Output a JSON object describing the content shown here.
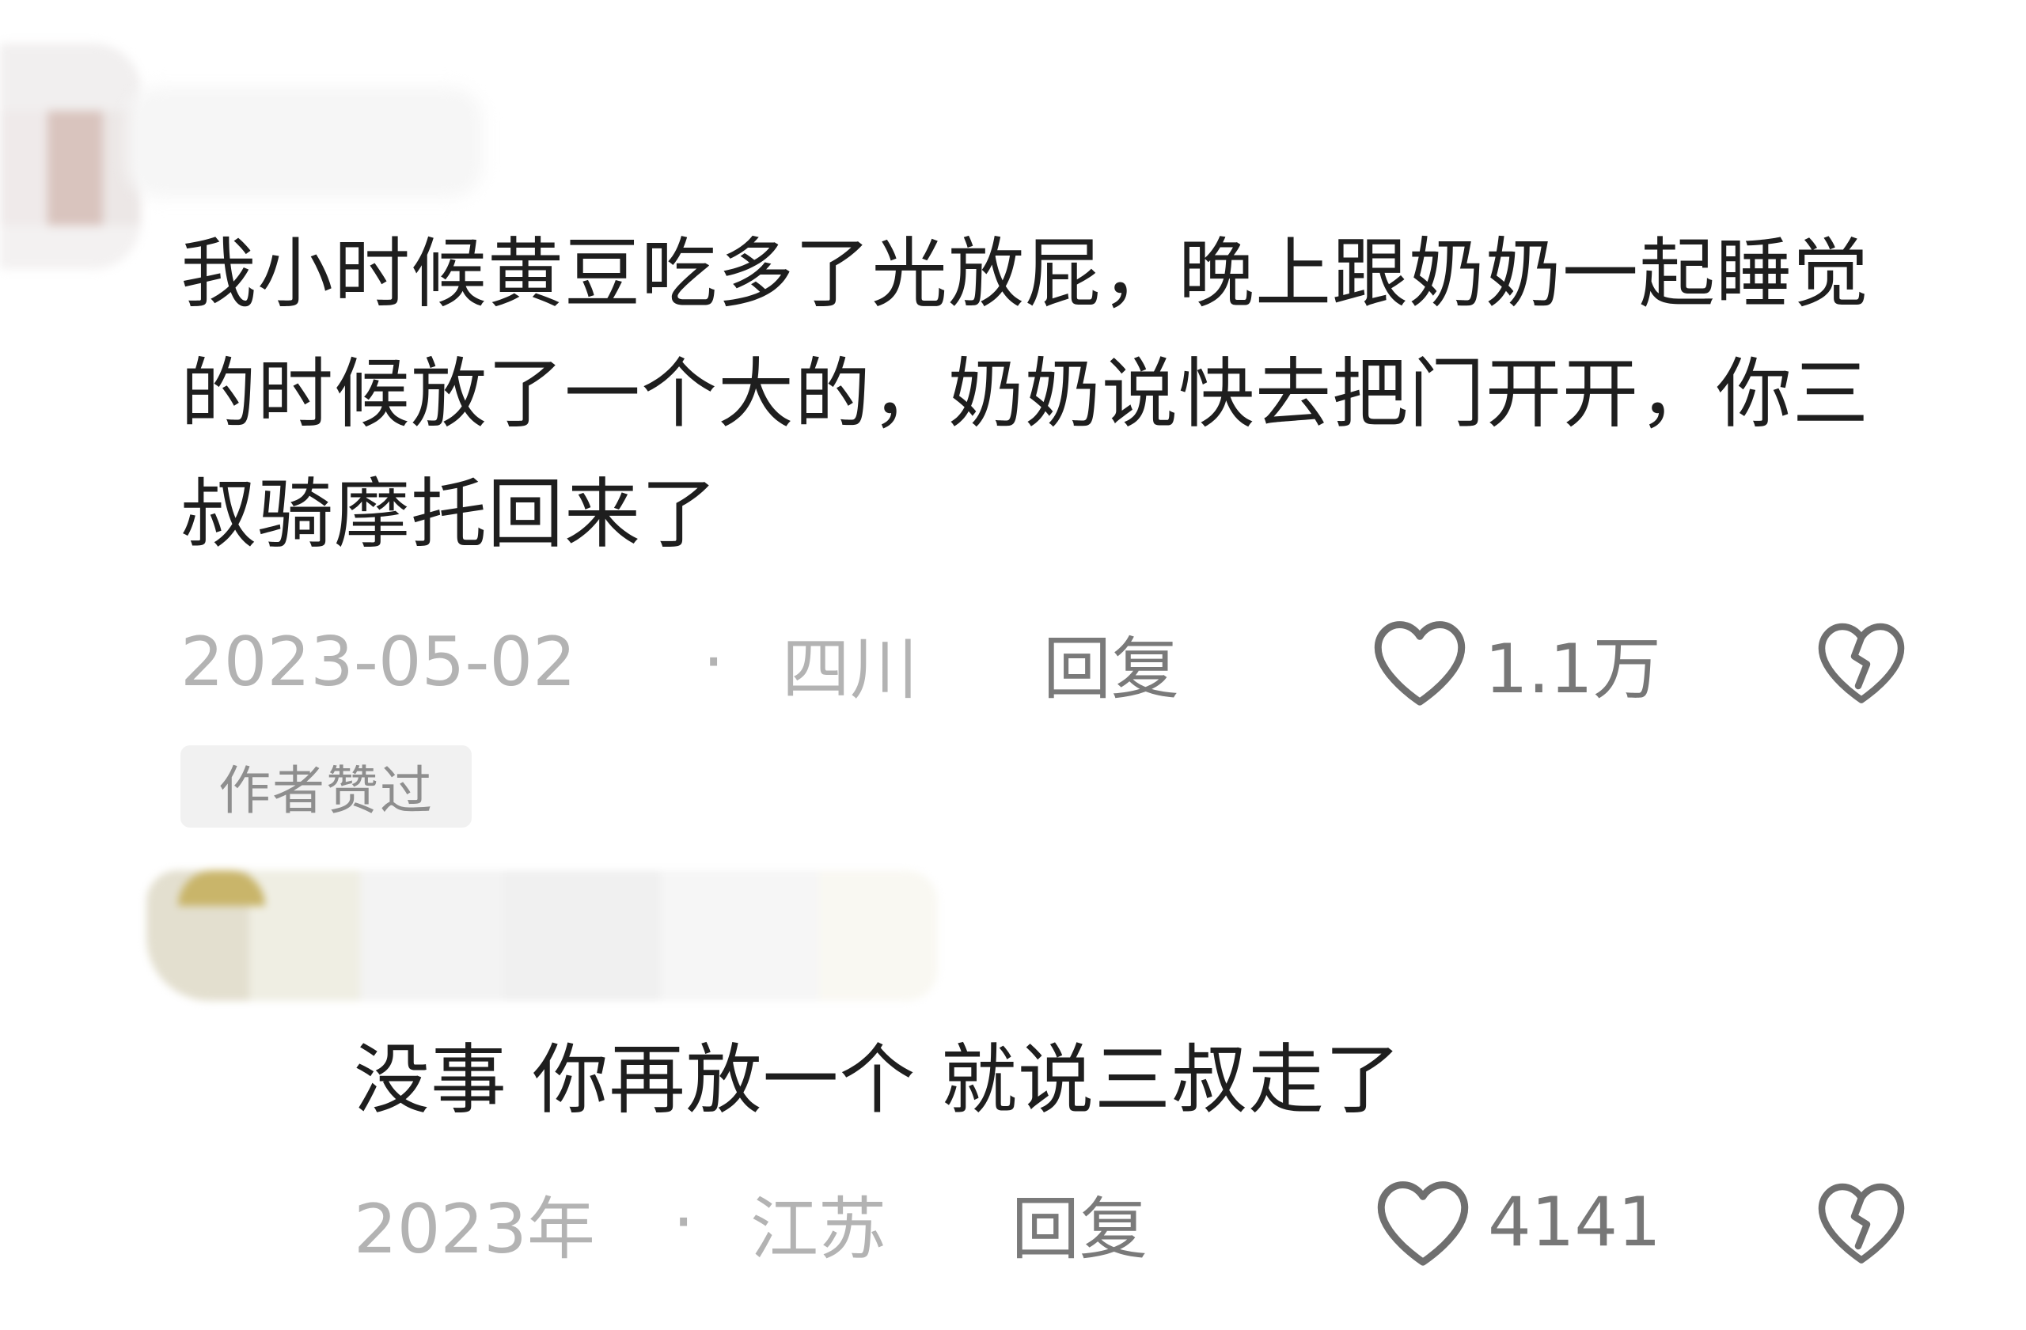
{
  "comments": [
    {
      "text": "我小时候黄豆吃多了光放屁，晚上跟奶奶一起睡觉的时候放了一个大的，奶奶说快去把门开开，你三叔骑摩托回来了",
      "date": "2023-05-02",
      "separator": "·",
      "location": "四川",
      "reply_label": "回复",
      "like_count": "1.1万",
      "badge": "作者赞过"
    },
    {
      "text": "没事 你再放一个 就说三叔走了",
      "date": "2023年",
      "separator": "·",
      "location": "江苏",
      "reply_label": "回复",
      "like_count": "4141"
    }
  ],
  "icons": {
    "like": "heart-outline-icon",
    "dislike": "broken-heart-outline-icon"
  },
  "colors": {
    "text": "#1e1e1e",
    "meta": "#b3b3b3",
    "icon": "#6f6f6f",
    "badge_bg": "#f1f1f1"
  }
}
